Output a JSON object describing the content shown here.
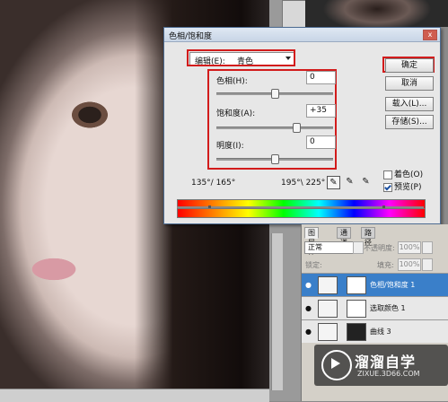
{
  "dialog": {
    "title": "色相/饱和度",
    "close_label": "x",
    "edit_label": "编辑(E):",
    "edit_value": "青色",
    "hue_label": "色相(H):",
    "hue_value": "0",
    "saturation_label": "饱和度(A):",
    "saturation_value": "+35",
    "lightness_label": "明度(I):",
    "lightness_value": "0",
    "buttons": {
      "ok": "确定",
      "cancel": "取消",
      "load": "载入(L)...",
      "save": "存储(S)..."
    },
    "colorize_label": "着色(O)",
    "preview_label": "预览(P)",
    "range_left": "135°/ 165°",
    "range_right": "195°\\ 225°",
    "colorize_checked": false,
    "preview_checked": true
  },
  "layers_panel": {
    "tabs": [
      "图层",
      "通道",
      "路径"
    ],
    "tab_close": "×",
    "blend_mode": "正常",
    "opacity_label": "不透明度:",
    "opacity_value": "100%",
    "lock_label": "锁定:",
    "fill_label": "填充:",
    "fill_value": "100%",
    "layers": [
      {
        "name": "色相/饱和度 1",
        "selected": true
      },
      {
        "name": "选取颜色 1",
        "selected": false
      },
      {
        "name": "曲线 3",
        "selected": false
      }
    ]
  },
  "watermark": {
    "text": "溜溜自学",
    "url": "ZIXUE.3D66.COM"
  }
}
